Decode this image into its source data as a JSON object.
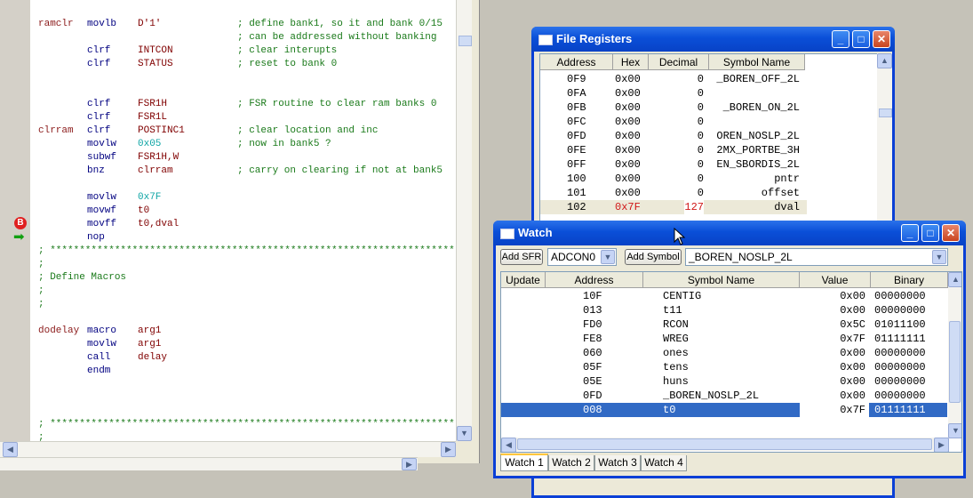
{
  "editor": {
    "code_lines": [
      {
        "label": "ramclr",
        "mnemonic": "movlb",
        "operand": "D'1'",
        "operand_num": false,
        "comment": "; define bank1, so it and bank 0/15"
      },
      {
        "label": "",
        "mnemonic": "",
        "operand": "",
        "operand_num": false,
        "comment": "; can be addressed without banking"
      },
      {
        "label": "",
        "mnemonic": "clrf",
        "operand": "INTCON",
        "operand_num": false,
        "comment": "; clear interupts"
      },
      {
        "label": "",
        "mnemonic": "clrf",
        "operand": "STATUS",
        "operand_num": false,
        "comment": "; reset to bank 0"
      },
      {
        "label": "",
        "mnemonic": "",
        "operand": "",
        "operand_num": false,
        "comment": ""
      },
      {
        "label": "",
        "mnemonic": "",
        "operand": "",
        "operand_num": false,
        "comment": ""
      },
      {
        "label": "",
        "mnemonic": "clrf",
        "operand": "FSR1H",
        "operand_num": false,
        "comment": "; FSR routine to clear ram banks 0"
      },
      {
        "label": "",
        "mnemonic": "clrf",
        "operand": "FSR1L",
        "operand_num": false,
        "comment": ""
      },
      {
        "label": "clrram",
        "mnemonic": "clrf",
        "operand": "POSTINC1",
        "operand_num": false,
        "comment": "; clear location and inc"
      },
      {
        "label": "",
        "mnemonic": "movlw",
        "operand": "0x05",
        "operand_num": true,
        "comment": "; now in bank5 ?"
      },
      {
        "label": "",
        "mnemonic": "subwf",
        "operand": "FSR1H,W",
        "operand_num": false,
        "comment": ""
      },
      {
        "label": "",
        "mnemonic": "bnz",
        "operand": "clrram",
        "operand_num": false,
        "comment": "; carry on clearing if not at bank5"
      },
      {
        "label": "",
        "mnemonic": "",
        "operand": "",
        "operand_num": false,
        "comment": ""
      },
      {
        "label": "",
        "mnemonic": "movlw",
        "operand": "0x7F",
        "operand_num": true,
        "comment": ""
      },
      {
        "label": "",
        "mnemonic": "movwf",
        "operand": "t0",
        "operand_num": false,
        "comment": ""
      },
      {
        "label": "",
        "mnemonic": "movff",
        "operand": "t0,dval",
        "operand_num": false,
        "comment": ""
      },
      {
        "label": "",
        "mnemonic": "nop",
        "operand": "",
        "operand_num": false,
        "comment": ""
      },
      {
        "full": "; *********************************************************************"
      },
      {
        "full": ";"
      },
      {
        "full": "; Define Macros"
      },
      {
        "full": ";"
      },
      {
        "full": ";"
      },
      {
        "label": "",
        "mnemonic": "",
        "operand": "",
        "operand_num": false,
        "comment": ""
      },
      {
        "label": "dodelay",
        "mnemonic": "macro",
        "operand": "arg1",
        "operand_num": false,
        "comment": ""
      },
      {
        "label": "",
        "mnemonic": "movlw",
        "operand": "arg1",
        "operand_num": false,
        "comment": ""
      },
      {
        "label": "",
        "mnemonic": "call",
        "operand": "delay",
        "operand_num": false,
        "comment": ""
      },
      {
        "label": "",
        "mnemonic": "endm",
        "operand": "",
        "operand_num": false,
        "comment": ""
      },
      {
        "label": "",
        "mnemonic": "",
        "operand": "",
        "operand_num": false,
        "comment": ""
      },
      {
        "label": "",
        "mnemonic": "",
        "operand": "",
        "operand_num": false,
        "comment": ""
      },
      {
        "label": "",
        "mnemonic": "",
        "operand": "",
        "operand_num": false,
        "comment": ""
      },
      {
        "full": "; *********************************************************************"
      },
      {
        "full": ";"
      }
    ],
    "breakpoint_glyph": "B",
    "pc_arrow_glyph": "➡"
  },
  "file_registers": {
    "title": "File Registers",
    "columns": [
      "Address",
      "Hex",
      "Decimal",
      "Symbol Name"
    ],
    "rows": [
      {
        "address": "0F9",
        "hex": "0x00",
        "decimal": "0",
        "symbol": "_BOREN_OFF_2L",
        "changed": false
      },
      {
        "address": "0FA",
        "hex": "0x00",
        "decimal": "0",
        "symbol": "",
        "changed": false
      },
      {
        "address": "0FB",
        "hex": "0x00",
        "decimal": "0",
        "symbol": "_BOREN_ON_2L",
        "changed": false
      },
      {
        "address": "0FC",
        "hex": "0x00",
        "decimal": "0",
        "symbol": "",
        "changed": false
      },
      {
        "address": "0FD",
        "hex": "0x00",
        "decimal": "0",
        "symbol": "OREN_NOSLP_2L",
        "changed": false
      },
      {
        "address": "0FE",
        "hex": "0x00",
        "decimal": "0",
        "symbol": "2MX_PORTBE_3H",
        "changed": false
      },
      {
        "address": "0FF",
        "hex": "0x00",
        "decimal": "0",
        "symbol": "EN_SBORDIS_2L",
        "changed": false
      },
      {
        "address": "100",
        "hex": "0x00",
        "decimal": "0",
        "symbol": "pntr",
        "changed": false
      },
      {
        "address": "101",
        "hex": "0x00",
        "decimal": "0",
        "symbol": "offset",
        "changed": false
      },
      {
        "address": "102",
        "hex": "0x7F",
        "decimal": "127",
        "symbol": "dval",
        "changed": true
      }
    ],
    "colors": {
      "changed": "#d01818",
      "title_bar": "#0a4fd8"
    }
  },
  "watch": {
    "title": "Watch",
    "add_sfr_label": "Add SFR",
    "sfr_select": "ADCON0",
    "add_symbol_label": "Add Symbol",
    "symbol_select": "_BOREN_NOSLP_2L",
    "columns": [
      "Update",
      "Address",
      "Symbol Name",
      "Value",
      "Binary"
    ],
    "rows": [
      {
        "address": "10F",
        "symbol": "CENTIG",
        "value": "0x00",
        "binary": "00000000",
        "selected": false
      },
      {
        "address": "013",
        "symbol": "t11",
        "value": "0x00",
        "binary": "00000000",
        "selected": false
      },
      {
        "address": "FD0",
        "symbol": "RCON",
        "value": "0x5C",
        "binary": "01011100",
        "selected": false
      },
      {
        "address": "FE8",
        "symbol": "WREG",
        "value": "0x7F",
        "binary": "01111111",
        "selected": false
      },
      {
        "address": "060",
        "symbol": "ones",
        "value": "0x00",
        "binary": "00000000",
        "selected": false
      },
      {
        "address": "05F",
        "symbol": "tens",
        "value": "0x00",
        "binary": "00000000",
        "selected": false
      },
      {
        "address": "05E",
        "symbol": "huns",
        "value": "0x00",
        "binary": "00000000",
        "selected": false
      },
      {
        "address": "0FD",
        "symbol": "_BOREN_NOSLP_2L",
        "value": "0x00",
        "binary": "00000000",
        "selected": false
      },
      {
        "address": "008",
        "symbol": "t0",
        "value": "0x7F",
        "binary": "01111111",
        "selected": true
      }
    ],
    "tabs": [
      "Watch 1",
      "Watch 2",
      "Watch 3",
      "Watch 4"
    ],
    "active_tab": 0
  }
}
